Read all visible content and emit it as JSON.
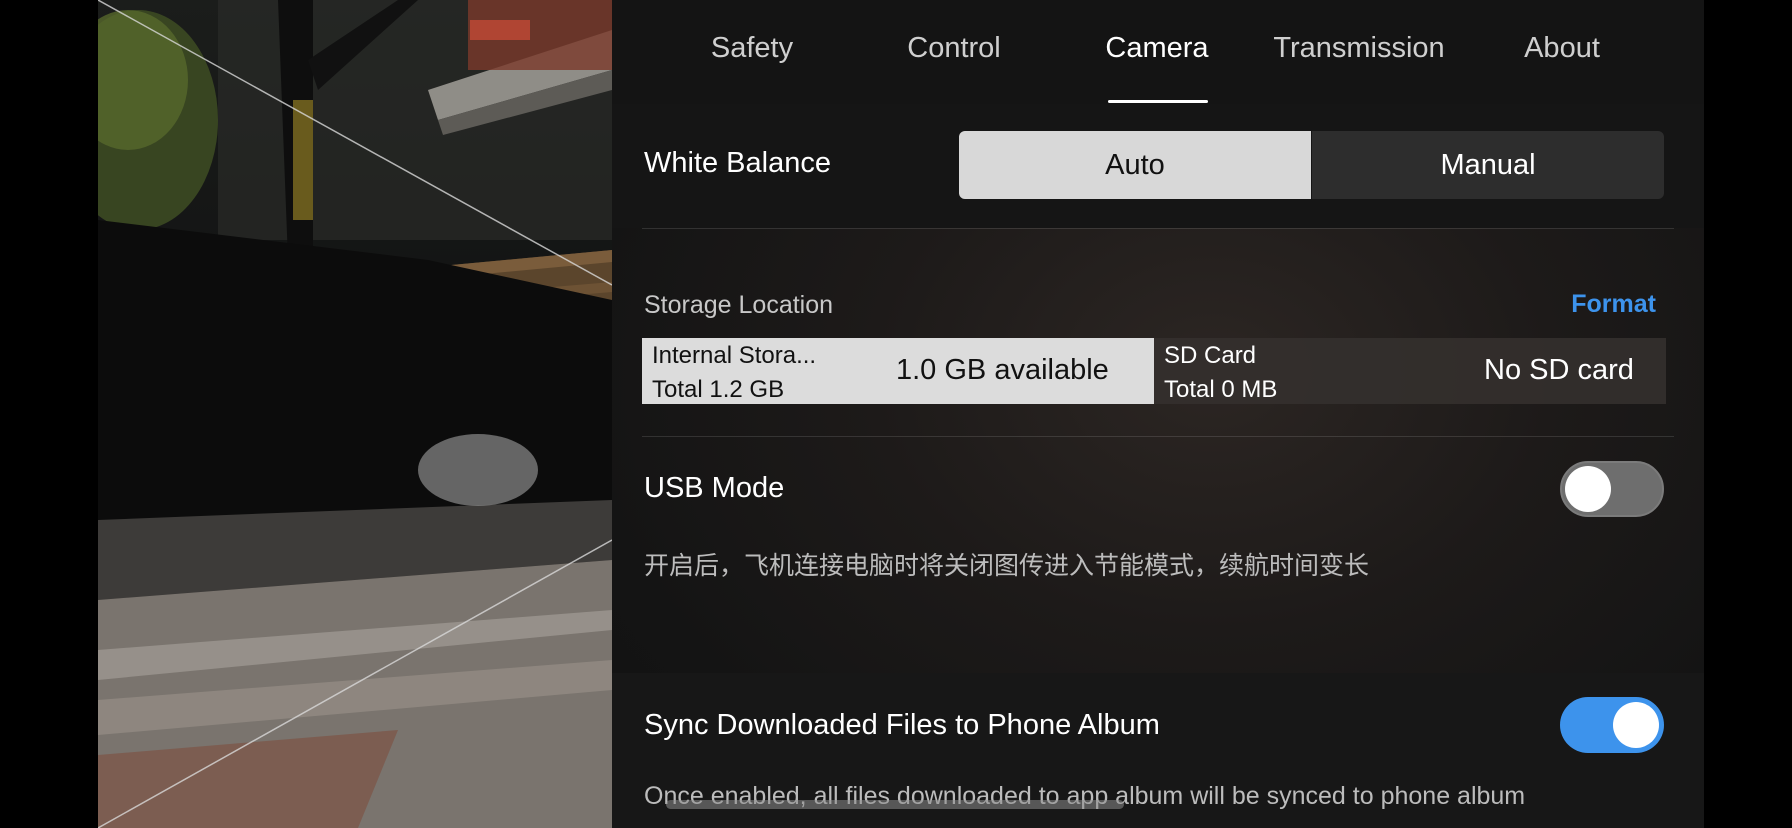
{
  "tabs": [
    {
      "label": "Safety",
      "active": false
    },
    {
      "label": "Control",
      "active": false
    },
    {
      "label": "Camera",
      "active": true
    },
    {
      "label": "Transmission",
      "active": false
    },
    {
      "label": "About",
      "active": false
    }
  ],
  "white_balance": {
    "label": "White Balance",
    "options": [
      "Auto",
      "Manual"
    ],
    "selected": "Auto"
  },
  "storage": {
    "label": "Storage Location",
    "format_label": "Format",
    "internal": {
      "name": "Internal Stora...",
      "total": "Total 1.2 GB",
      "available": "1.0 GB available",
      "selected": true
    },
    "sd_card": {
      "name": "SD Card",
      "total": "Total 0 MB",
      "available": "No SD card",
      "selected": false
    }
  },
  "usb_mode": {
    "label": "USB Mode",
    "enabled": false,
    "description": "开启后，飞机连接电脑时将关闭图传进入节能模式，续航时间变长"
  },
  "sync_album": {
    "label": "Sync Downloaded Files to Phone Album",
    "enabled": true,
    "description": "Once enabled, all files downloaded to app album will be synced to phone album"
  },
  "colors": {
    "accent": "#3d93ec",
    "selected_segment": "#d8d8d8",
    "panel_background": "#141414"
  }
}
